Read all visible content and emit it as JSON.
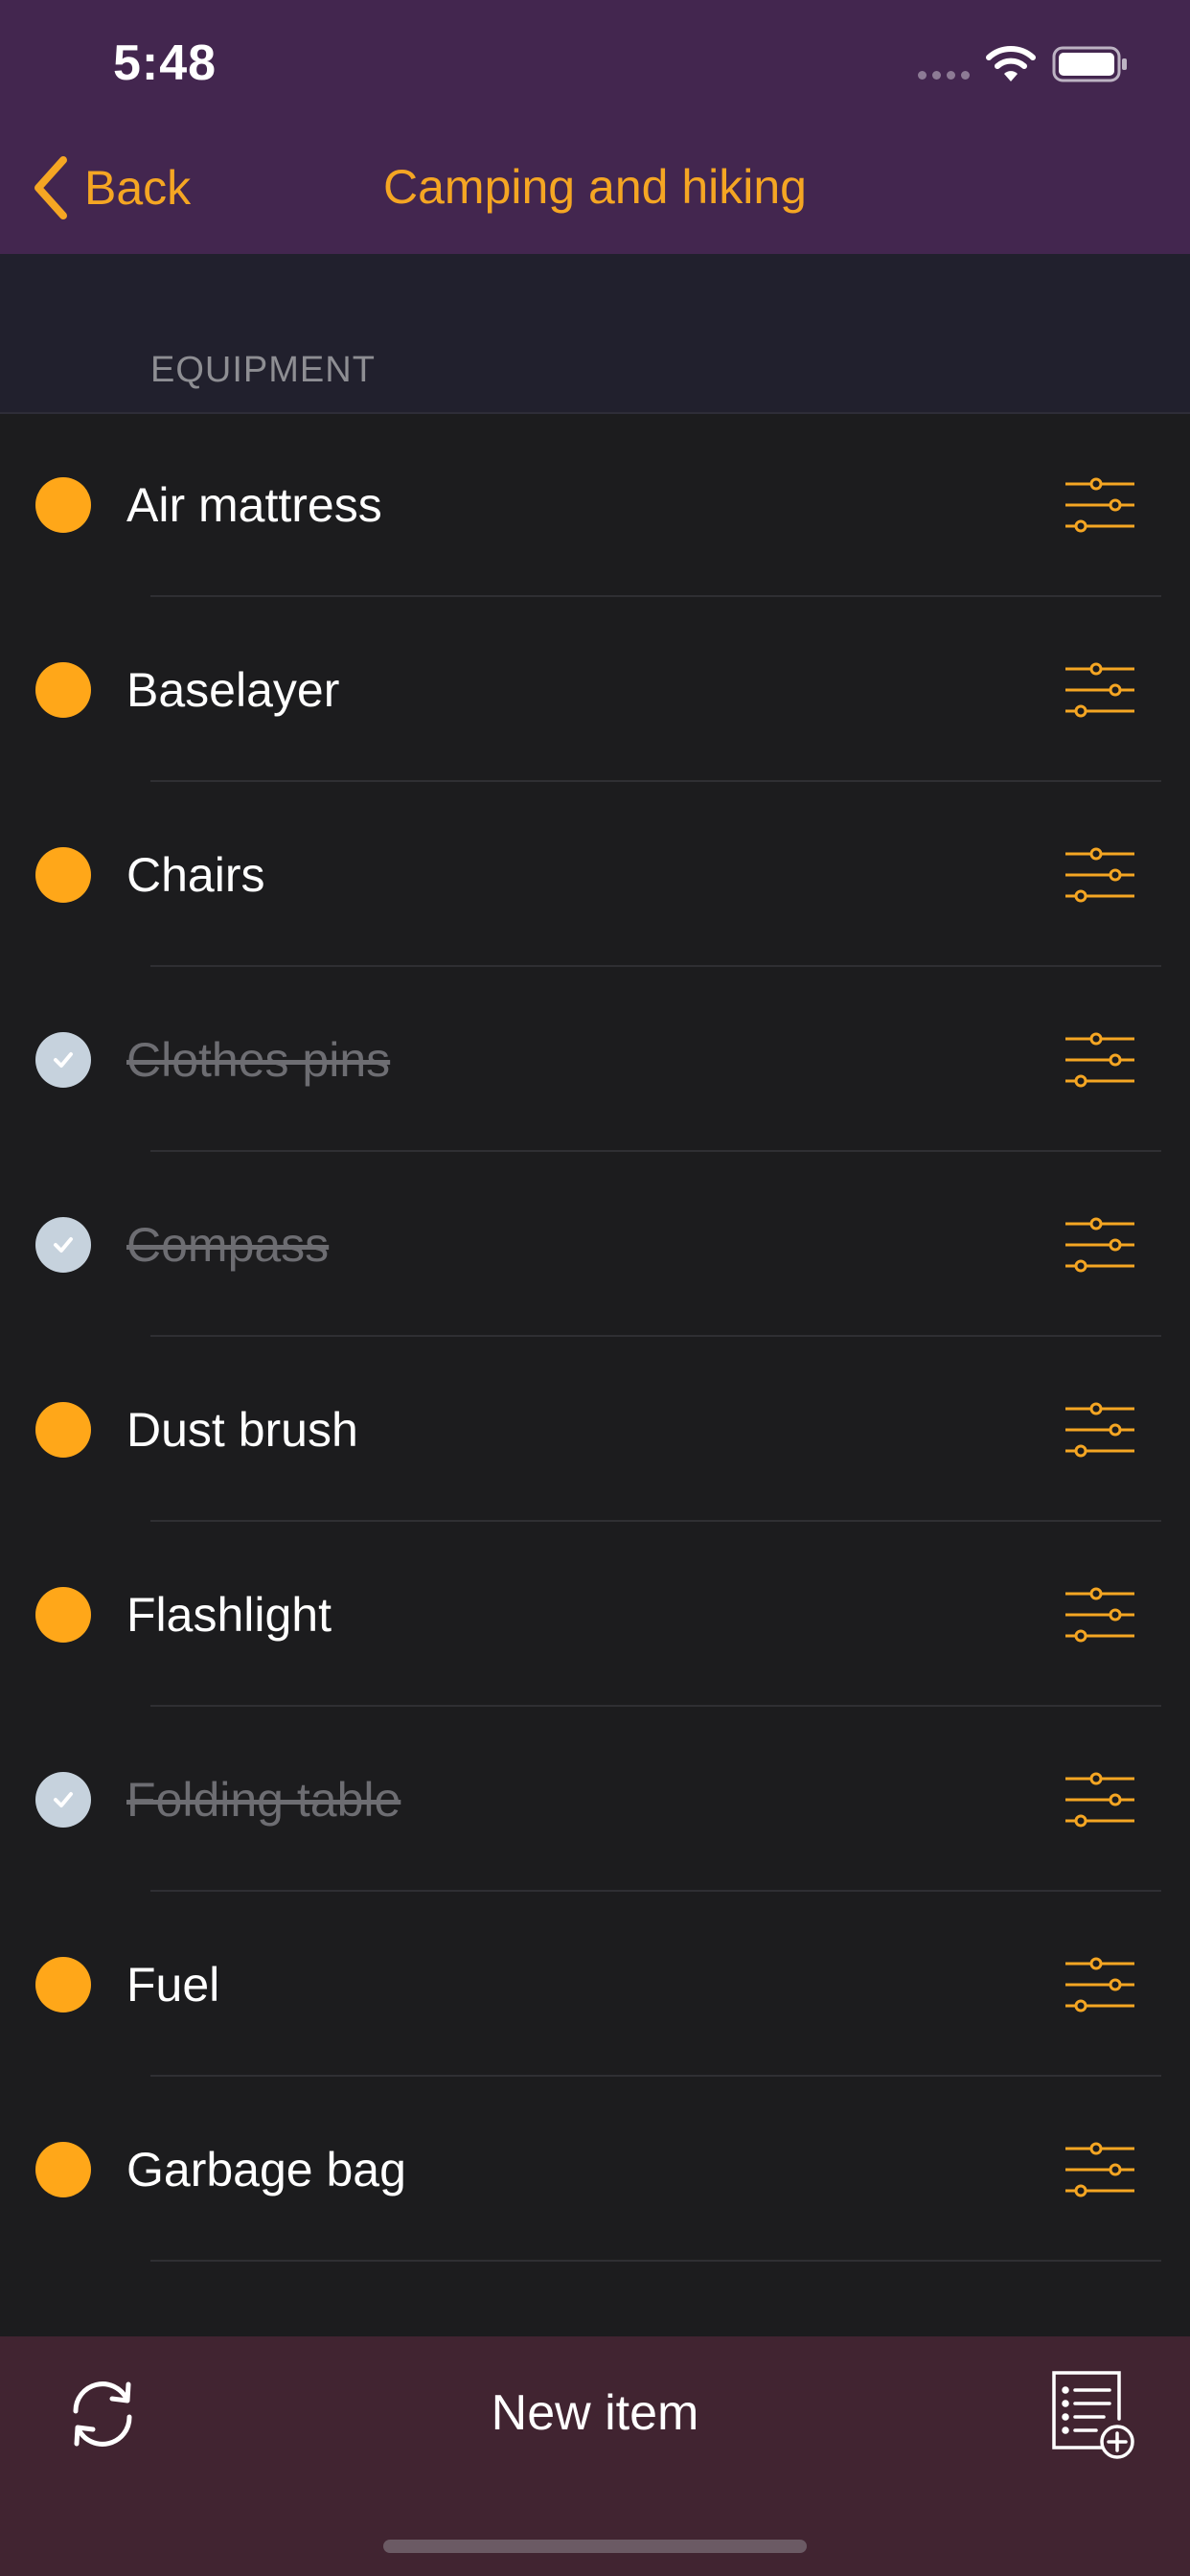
{
  "status_bar": {
    "time": "5:48"
  },
  "nav": {
    "back_label": "Back",
    "title": "Camping and hiking"
  },
  "section": {
    "title": "EQUIPMENT"
  },
  "items": [
    {
      "label": "Air mattress",
      "done": false
    },
    {
      "label": "Baselayer",
      "done": false
    },
    {
      "label": "Chairs",
      "done": false
    },
    {
      "label": "Clothes pins",
      "done": true
    },
    {
      "label": "Compass",
      "done": true
    },
    {
      "label": "Dust brush",
      "done": false
    },
    {
      "label": "Flashlight",
      "done": false
    },
    {
      "label": "Folding table",
      "done": true
    },
    {
      "label": "Fuel",
      "done": false
    },
    {
      "label": "Garbage bag",
      "done": false
    },
    {
      "label": "",
      "done": false
    }
  ],
  "toolbar": {
    "new_item_label": "New item"
  },
  "colors": {
    "accent": "#f5a623",
    "header_bg": "#43264f",
    "toolbar_bg": "#412431",
    "list_bg": "#1c1c1e",
    "done_check": "#c6d2dd"
  }
}
